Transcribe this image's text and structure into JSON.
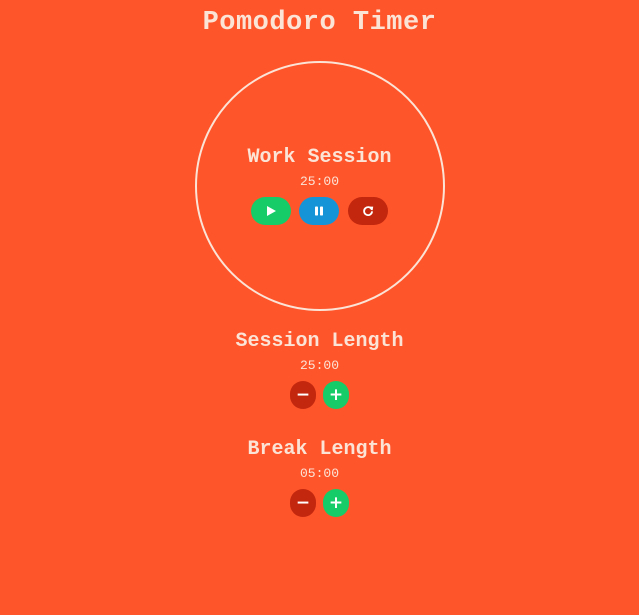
{
  "app": {
    "title": "Pomodoro Timer"
  },
  "timer": {
    "session_name": "Work Session",
    "time_display": "25:00",
    "controls": [
      {
        "name": "play",
        "icon": "play-icon",
        "color": "#16cc68"
      },
      {
        "name": "pause",
        "icon": "pause-icon",
        "color": "#1595d8"
      },
      {
        "name": "reset",
        "icon": "reset-icon",
        "color": "#c3270e"
      }
    ]
  },
  "session_length": {
    "title": "Session Length",
    "value": "25:00",
    "decrement_label": "−",
    "increment_label": "+"
  },
  "break_length": {
    "title": "Break Length",
    "value": "05:00",
    "decrement_label": "−",
    "increment_label": "+"
  },
  "colors": {
    "background": "#ff552a",
    "text": "#fbe3d6",
    "green": "#16cc68",
    "blue": "#1595d8",
    "red": "#c3270e"
  }
}
